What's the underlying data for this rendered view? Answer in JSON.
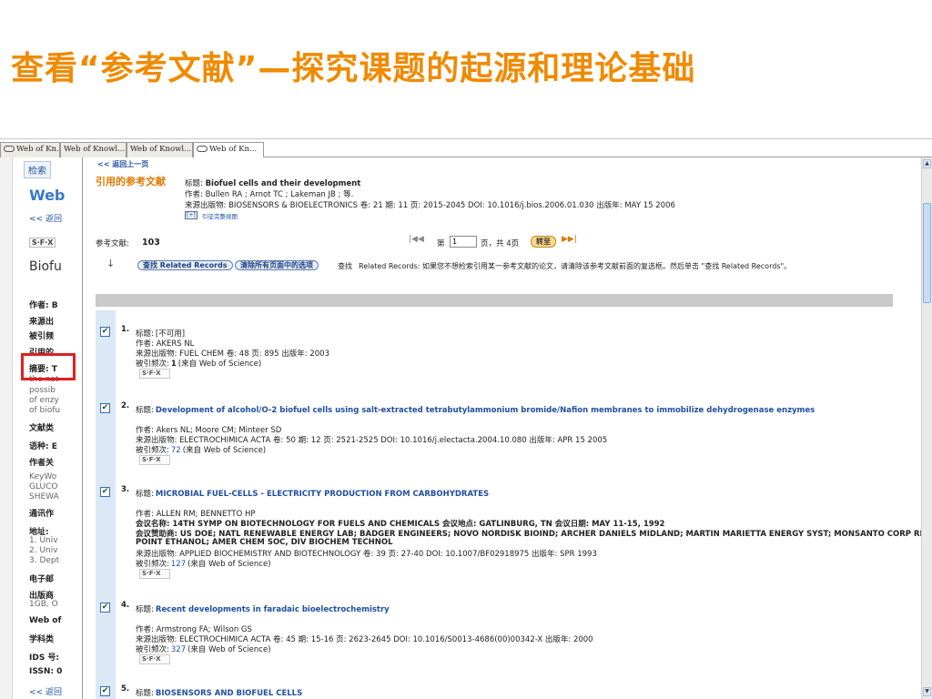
{
  "slide": {
    "title": "查看“参考文献”—探究课题的起源和理论基础"
  },
  "tabs": [
    {
      "label": "Web of Kn..."
    },
    {
      "label": "Web of Knowl..."
    },
    {
      "label": "Web of Knowl..."
    },
    {
      "label": "Web of Kn..."
    }
  ],
  "background_page": {
    "tab_label": "检索",
    "brand": "Web",
    "back_link": "<< 返回",
    "sfx": "S·F·X",
    "doc_title": "Biofu",
    "lines": [
      {
        "text": "作者: B",
        "style": "b"
      },
      {
        "text": "来源出",
        "style": "b"
      },
      {
        "text": "被引频",
        "style": "b"
      },
      {
        "text": "引用的",
        "style": "b"
      },
      {
        "text": "摘要: T",
        "style": "b"
      },
      {
        "text": "the nat",
        "style": "g"
      },
      {
        "text": "possib",
        "style": "g"
      },
      {
        "text": "of enzy",
        "style": "g"
      },
      {
        "text": "of biofu",
        "style": "g"
      },
      {
        "text": "文献类",
        "style": "b"
      },
      {
        "text": "语种: E",
        "style": "b"
      },
      {
        "text": "作者关",
        "style": "b"
      },
      {
        "text": "KeyWo",
        "style": "g"
      },
      {
        "text": "GLUCO",
        "style": "g"
      },
      {
        "text": "SHEWA",
        "style": "g"
      },
      {
        "text": "通讯作",
        "style": "b"
      },
      {
        "text": "地址:",
        "style": "b"
      },
      {
        "text": "1. Univ",
        "style": "g"
      },
      {
        "text": "2. Univ",
        "style": "g"
      },
      {
        "text": "3. Dept",
        "style": "g"
      },
      {
        "text": "电子邮",
        "style": "b"
      },
      {
        "text": "出版商",
        "style": "b"
      },
      {
        "text": "1GB, O",
        "style": "g"
      },
      {
        "text": "Web of",
        "style": "b"
      },
      {
        "text": "学科类",
        "style": "b"
      },
      {
        "text": "IDS 号:",
        "style": "b"
      },
      {
        "text": "ISSN: 0",
        "style": "b"
      },
      {
        "text": "<< 返回",
        "style": "link"
      }
    ]
  },
  "fg": {
    "back_link": "<< 返回上一页",
    "heading": "引用的参考文献",
    "source": {
      "title_label": "标题:",
      "title": "Biofuel cells and their development",
      "authors": "作者: Bullen RA ; Arnot TC ; Lakeman JB ; 等.",
      "pub": "来源出版物: BIOSENSORS & BIOELECTRONICS 卷: 21  期: 11  页: 2015-2045  DOI: 10.1016/j.bios.2006.01.030  出版年: MAY 15 2006",
      "more_btn": "[+]",
      "more_label": "引征完整视图"
    },
    "ref_count_label": "参考文献:",
    "ref_count": "103",
    "pager": {
      "page_label": "第",
      "page_value": "1",
      "of_label": "页，共 4页",
      "go": "转至"
    },
    "find_related_btn": "查找 Related Records",
    "clear_btn": "清除所有页面中的选项",
    "find_label": "查找",
    "find_note": "Related Records: 如果您不想检索引用某一参考文献的论文，请清除该参考文献前面的复选框。然后单击 \"查找  Related Records\"。"
  },
  "records": [
    {
      "num": "1.",
      "title_label": "标题:",
      "title": "[不可用]",
      "title_link": false,
      "lines": [
        "作者: AKERS NL",
        "来源出版物: FUEL CHEM 卷: 48  页: 895  出版年: 2003"
      ],
      "cited_label": "被引频次:",
      "cited": "1",
      "cited_suffix": "(来自 Web of Science)",
      "cited_link": false,
      "sfx": "S·F·X"
    },
    {
      "num": "2.",
      "title_label": "标题:",
      "title": "Development of alcohol/O-2 biofuel cells using salt-extracted tetrabutylammonium bromide/Nafion membranes to immobilize dehydrogenase enzymes",
      "title_link": true,
      "lines": [
        "作者: Akers NL; Moore CM; Minteer SD",
        "来源出版物: ELECTROCHIMICA ACTA 卷: 50  期: 12  页: 2521-2525  DOI: 10.1016/j.electacta.2004.10.080  出版年: APR 15 2005"
      ],
      "cited_label": "被引频次:",
      "cited": "72",
      "cited_suffix": "(来自  Web of Science)",
      "cited_link": true,
      "sfx": "S·F·X"
    },
    {
      "num": "3.",
      "title_label": "标题:",
      "title": "MICROBIAL FUEL-CELLS - ELECTRICITY PRODUCTION FROM CARBOHYDRATES",
      "title_link": true,
      "lines": [
        "作者: ALLEN RM; BENNETTO HP",
        "会议名称: 14TH SYMP ON BIOTECHNOLOGY FOR FUELS AND CHEMICALS 会议地点: GATLINBURG, TN 会议日期: MAY 11-15, 1992",
        "会议赞助商: US DOE; NATL RENEWABLE ENERGY LAB; BADGER ENGINEERS; NOVO NORDISK BIOIND; ARCHER DANIELS MIDLAND; MARTIN MARIETTA ENERGY SYST; MONSANTO CORP RES; SOUTH",
        "POINT ETHANOL; AMER CHEM SOC, DIV BIOCHEM TECHNOL",
        "来源出版物: APPLIED BIOCHEMISTRY AND BIOTECHNOLOGY 卷: 39  页: 27-40  DOI: 10.1007/BF02918975  出版年: SPR 1993"
      ],
      "cited_label": "被引频次:",
      "cited": "127",
      "cited_suffix": "(来自  Web of Science)",
      "cited_link": true,
      "sfx": "S·F·X"
    },
    {
      "num": "4.",
      "title_label": "标题:",
      "title": "Recent developments in faradaic bioelectrochemistry",
      "title_link": true,
      "lines": [
        "作者: Armstrong FA; Wilson GS",
        "来源出版物: ELECTROCHIMICA ACTA 卷: 45  期: 15-16  页: 2623-2645  DOI: 10.1016/S0013-4686(00)00342-X  出版年: 2000"
      ],
      "cited_label": "被引频次:",
      "cited": "327",
      "cited_suffix": "(来自  Web of Science)",
      "cited_link": true,
      "sfx": "S·F·X"
    },
    {
      "num": "5.",
      "title_label": "标题:",
      "title": "BIOSENSORS AND BIOFUEL CELLS",
      "title_link": true,
      "lines": [
        "作者: ASTON WJ; TURNER APF"
      ],
      "cited_label": "",
      "cited": "",
      "cited_suffix": "",
      "cited_link": true,
      "sfx": ""
    }
  ],
  "colors": {
    "title_orange": "#f08a00",
    "heading_orange": "#e07800",
    "link_blue": "#1f4fa0",
    "highlight_red": "#e02020",
    "record_stripe": "#dbe9f6"
  }
}
